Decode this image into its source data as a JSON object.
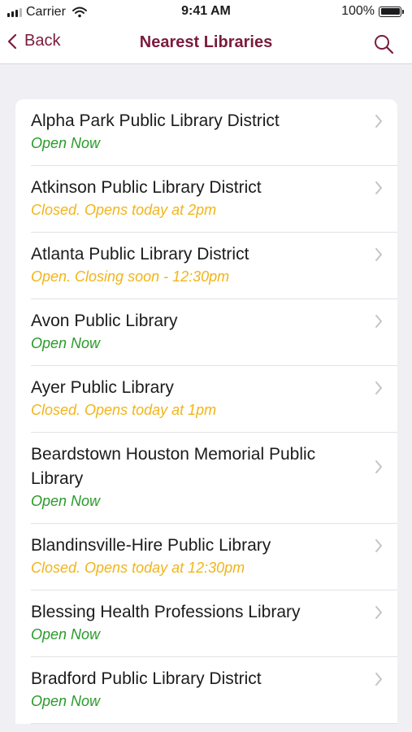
{
  "status_bar": {
    "carrier": "Carrier",
    "time": "9:41 AM",
    "battery": "100%",
    "icons": [
      "signal-icon",
      "wifi-icon",
      "battery-icon"
    ]
  },
  "nav": {
    "back_label": "Back",
    "title": "Nearest Libraries",
    "icons": [
      "chevron-left-icon",
      "search-icon"
    ]
  },
  "colors": {
    "accent": "#7a1b3d",
    "open": "#2a9a2a",
    "closed": "#f2b418",
    "background": "#efeff4"
  },
  "libraries": [
    {
      "name": "Alpha Park Public Library District",
      "status": "Open Now"
    },
    {
      "name": "Atkinson Public Library District",
      "status": "Closed. Opens today at 2pm"
    },
    {
      "name": "Atlanta Public Library District",
      "status": "Open. Closing soon - 12:30pm"
    },
    {
      "name": "Avon Public Library",
      "status": "Open Now"
    },
    {
      "name": "Ayer Public Library",
      "status": "Closed. Opens today at 1pm"
    },
    {
      "name": "Beardstown Houston Memorial Public Library",
      "status": "Open Now"
    },
    {
      "name": "Blandinsville-Hire Public Library",
      "status": "Closed. Opens today at 12:30pm"
    },
    {
      "name": "Blessing Health Professions Library",
      "status": "Open Now"
    },
    {
      "name": "Bradford Public Library District",
      "status": "Open Now"
    }
  ]
}
